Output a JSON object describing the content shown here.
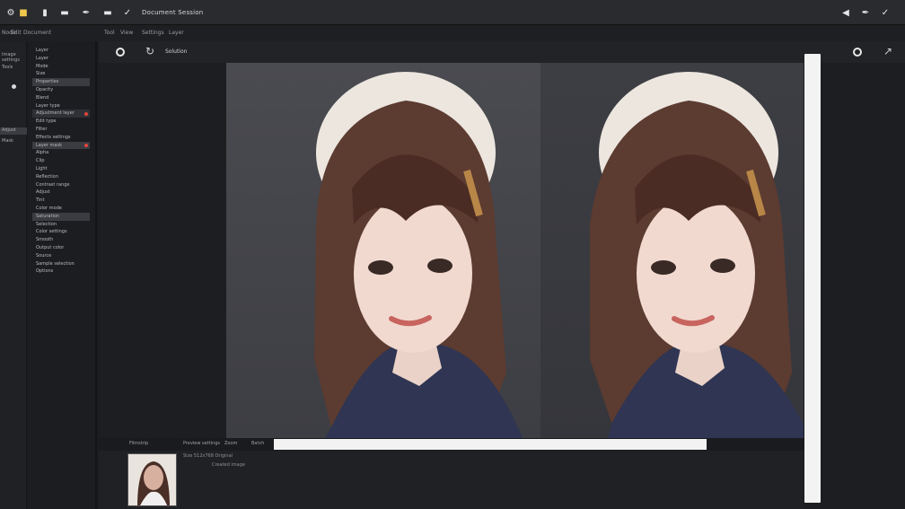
{
  "window": {
    "title": "Document Session"
  },
  "toolbar": {
    "icons": [
      "options-icon",
      "folder-icon",
      "layers-icon",
      "menu-icon",
      "brush-icon",
      "menu-lines-icon",
      "pen-icon"
    ],
    "right_icons": [
      "left-arrow-icon",
      "pencil-icon",
      "check-icon"
    ]
  },
  "menu": {
    "items": [
      "Node",
      "Edit",
      "Document"
    ],
    "right_items": [
      "Tool",
      "View",
      "Settings",
      "Layer"
    ]
  },
  "left_sidebar": {
    "items": [
      "Image settings",
      "Tools",
      "Adjust",
      "Mask"
    ]
  },
  "panel": {
    "items": [
      {
        "label": "Layer",
        "state": "normal"
      },
      {
        "label": "Layer",
        "state": "normal"
      },
      {
        "label": "Mode",
        "state": "normal"
      },
      {
        "label": "Size",
        "state": "normal"
      },
      {
        "label": "Properties",
        "state": "hl"
      },
      {
        "label": "Opacity",
        "state": "normal"
      },
      {
        "label": "Blend",
        "state": "normal"
      },
      {
        "label": "Layer type",
        "state": "normal"
      },
      {
        "label": "Adjustment layer",
        "state": "sel",
        "dot": true
      },
      {
        "label": "Edit type",
        "state": "normal"
      },
      {
        "label": "Filter",
        "state": "normal"
      },
      {
        "label": "Effects settings",
        "state": "normal"
      },
      {
        "label": "Layer mask",
        "state": "hl",
        "dot": true
      },
      {
        "label": "Alpha",
        "state": "normal"
      },
      {
        "label": "Clip",
        "state": "normal"
      },
      {
        "label": "Light",
        "state": "normal"
      },
      {
        "label": "Reflection",
        "state": "normal"
      },
      {
        "label": "Contrast range",
        "state": "normal"
      },
      {
        "label": "Adjust",
        "state": "normal"
      },
      {
        "label": "Tint",
        "state": "normal"
      },
      {
        "label": "Color mode",
        "state": "normal"
      },
      {
        "label": "Saturation",
        "state": "hl"
      },
      {
        "label": "Selection",
        "state": "normal"
      },
      {
        "label": "Color settings",
        "state": "normal"
      },
      {
        "label": "Smooth",
        "state": "normal"
      },
      {
        "label": "Output color",
        "state": "normal"
      },
      {
        "label": "Source",
        "state": "normal"
      },
      {
        "label": "Sample selection",
        "state": "normal"
      },
      {
        "label": "Options",
        "state": "normal"
      }
    ]
  },
  "workspace": {
    "view_label": "Solution"
  },
  "filmstrip": {
    "labels": [
      "Filmstrip",
      "Preview settings",
      "Zoom",
      "Batch"
    ],
    "meta": [
      "Size 512x768 Original",
      "Created image"
    ]
  }
}
